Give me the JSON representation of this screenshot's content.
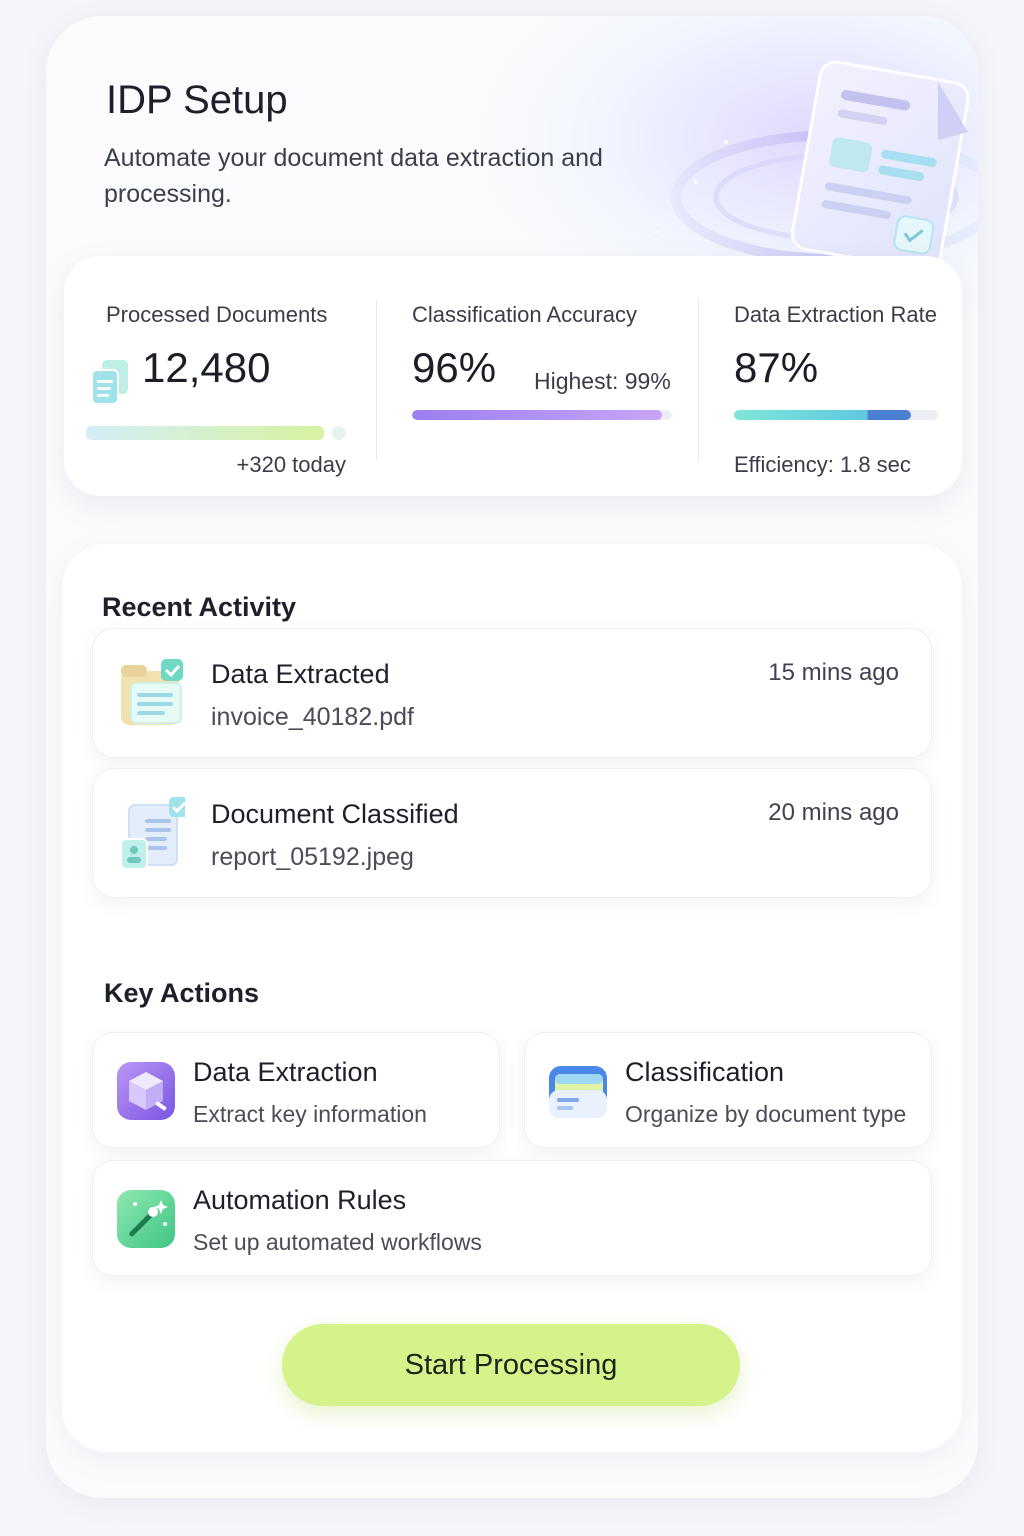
{
  "header": {
    "title": "IDP Setup",
    "subtitle": "Automate your document data extraction and processing."
  },
  "stats": {
    "processed": {
      "label": "Processed Documents",
      "value": "12,480",
      "sub": "+320 today",
      "icon": "documents-stack-icon"
    },
    "accuracy": {
      "label": "Classification Accuracy",
      "value": "96%",
      "sub": "Highest: 99%",
      "progress": 0.96
    },
    "extraction": {
      "label": "Data Extraction Rate",
      "value": "87%",
      "sub": "Efficiency: 1.8 sec",
      "progress": 0.87
    }
  },
  "recent_activity": {
    "title": "Recent Activity",
    "items": [
      {
        "title": "Data Extracted",
        "file": "invoice_40182.pdf",
        "time": "15 mins ago",
        "icon": "folder-check-icon"
      },
      {
        "title": "Document Classified",
        "file": "report_05192.jpeg",
        "time": "20 mins ago",
        "icon": "document-check-icon"
      }
    ]
  },
  "key_actions": {
    "title": "Key Actions",
    "items": [
      {
        "title": "Data Extraction",
        "desc": "Extract key information",
        "icon": "cube-icon"
      },
      {
        "title": "Classification",
        "desc": "Organize by document type",
        "icon": "folder-icon"
      },
      {
        "title": "Automation Rules",
        "desc": "Set up automated workflows",
        "icon": "magic-wand-icon"
      }
    ]
  },
  "cta": {
    "label": "Start Processing"
  },
  "colors": {
    "accent_green": "#d6f28a",
    "accent_purple": "#9b7ef0",
    "accent_teal": "#6fe0d0",
    "accent_blue": "#4a7fd4"
  }
}
